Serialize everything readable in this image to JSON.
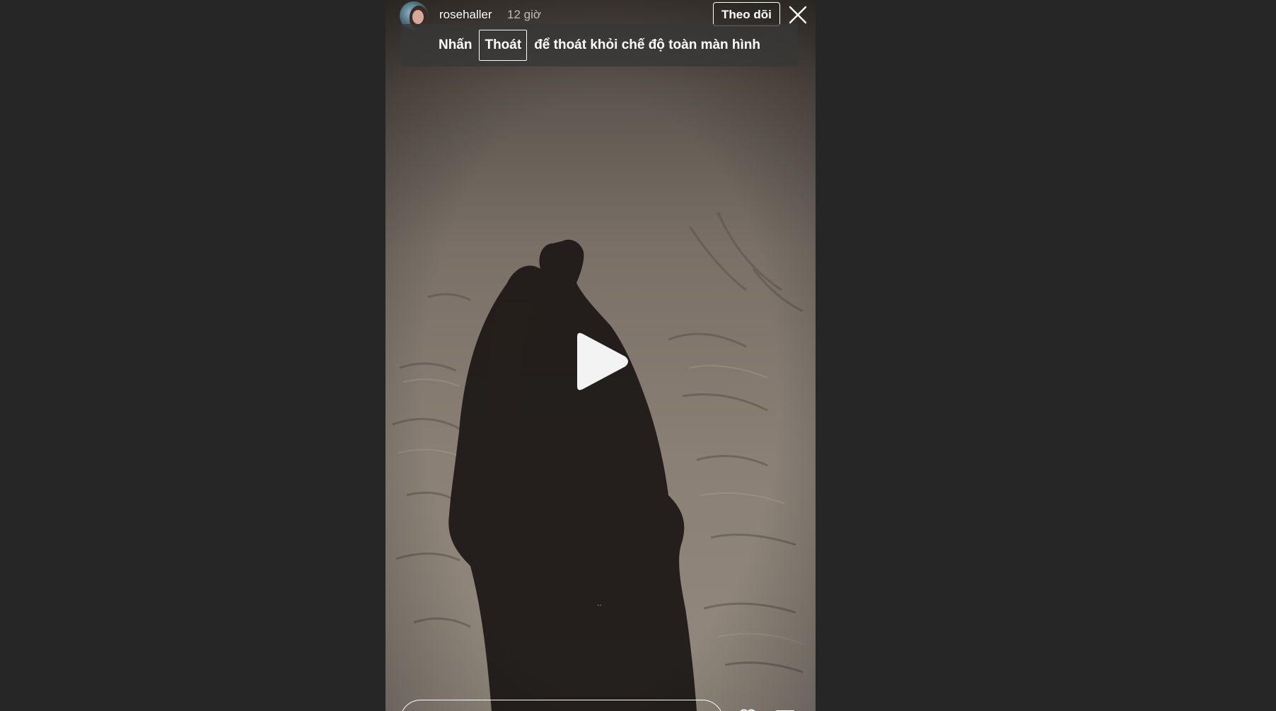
{
  "story": {
    "username": "rosehaller",
    "time_ago": "12 giờ",
    "follow_label": "Theo dõi",
    "media_description_icon": "play-icon"
  },
  "fullscreen_notice": {
    "prefix": "Nhấn",
    "key_label": "Thoát",
    "suffix": "để thoát khỏi chế độ toàn màn hình"
  },
  "overlay": {
    "mid_dots": "··"
  },
  "icons": {
    "close": "close-icon",
    "play": "play-icon",
    "heart": "heart-icon",
    "send": "send-icon"
  },
  "colors": {
    "page_background": "#262626",
    "text": "#ffffff",
    "timestamp": "#bdbdbd",
    "banner_background": "#373737"
  }
}
